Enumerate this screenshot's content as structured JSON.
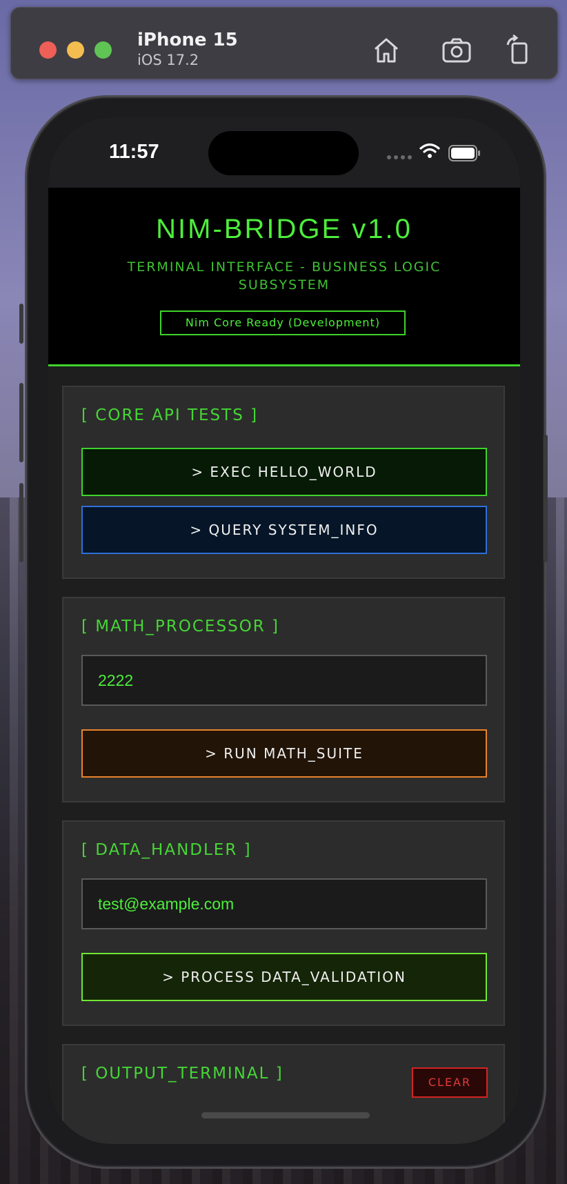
{
  "simulator": {
    "device_name": "iPhone 15",
    "os_version": "iOS 17.2",
    "icons": [
      "home-icon",
      "screenshot-icon",
      "rotate-icon"
    ]
  },
  "statusbar": {
    "time": "11:57",
    "icons": [
      "cellular-dots-icon",
      "wifi-icon",
      "battery-icon"
    ]
  },
  "header": {
    "title": "NIM-BRIDGE v1.0",
    "subtitle": "TERMINAL INTERFACE - BUSINESS LOGIC SUBSYSTEM",
    "status": "Nim Core Ready (Development)"
  },
  "core_api": {
    "title": "[ CORE API TESTS ]",
    "hello_button": "> EXEC HELLO_WORLD",
    "sysinfo_button": "> QUERY SYSTEM_INFO"
  },
  "math": {
    "title": "[ MATH_PROCESSOR ]",
    "input_value": "2222",
    "run_button": "> RUN MATH_SUITE"
  },
  "data_handler": {
    "title": "[ DATA_HANDLER ]",
    "input_value": "test@example.com",
    "process_button": "> PROCESS DATA_VALIDATION"
  },
  "output": {
    "title": "[ OUTPUT_TERMINAL ]",
    "clear_button": "CLEAR"
  },
  "colors": {
    "accent_green": "#4dee3b",
    "accent_blue": "#2f6fd8",
    "accent_orange": "#e8822c",
    "danger_red": "#d42424"
  }
}
